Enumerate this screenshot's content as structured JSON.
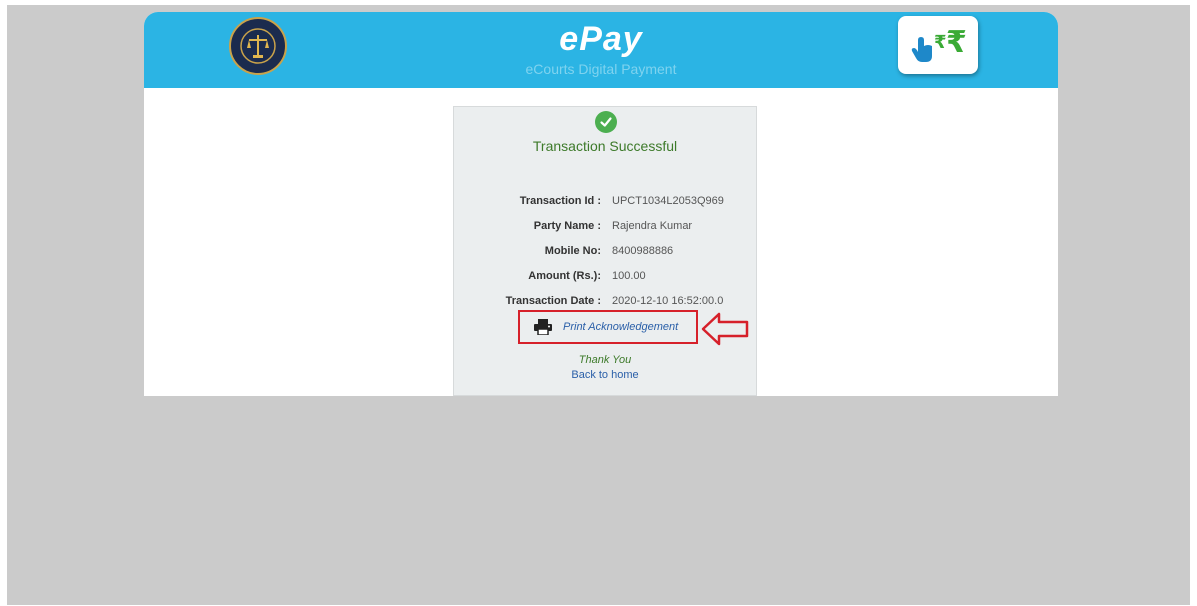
{
  "header": {
    "title": "ePay",
    "subtitle": "eCourts Digital Payment",
    "emblem_icon": "court-emblem-icon",
    "app_icon": "rupee-tap-icon",
    "brand_color": "#2bb4e4"
  },
  "receipt": {
    "status": "Transaction Successful",
    "status_icon": "check-circle-icon",
    "status_color": "#4caf50",
    "details": [
      {
        "label": "Transaction Id :",
        "value": "UPCT1034L2053Q969"
      },
      {
        "label": "Party Name :",
        "value": "Rajendra Kumar"
      },
      {
        "label": "Mobile No:",
        "value": "8400988886"
      },
      {
        "label": "Amount (Rs.):",
        "value": "100.00"
      },
      {
        "label": "Transaction Date :",
        "value": "2020-12-10 16:52:00.0"
      }
    ],
    "print_label": "Print Acknowledgement",
    "print_icon": "printer-icon",
    "annotation_icon": "red-arrow-icon",
    "annotation_color": "#d6202a",
    "thank_you": "Thank You",
    "back_label": "Back to home"
  }
}
